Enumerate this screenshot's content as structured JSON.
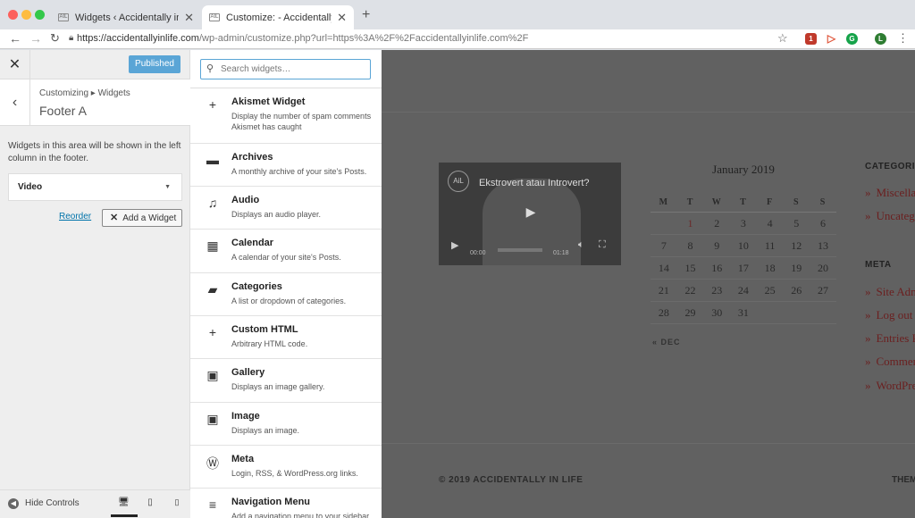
{
  "browser": {
    "tabs": [
      {
        "title": "Widgets ‹ Accidentally in Life —",
        "fav": "AIL",
        "close": "✕"
      },
      {
        "title": "Customize: - Accidentally in Life",
        "fav": "AIL",
        "close": "✕"
      }
    ],
    "new_tab": "+",
    "url_host": "https://accidentallyinlife.com",
    "url_path": "/wp-admin/customize.php?url=https%3A%2F%2Faccidentallyinlife.com%2F",
    "profile_initial": "L",
    "ext_badge": "1"
  },
  "customizer": {
    "published_label": "Published",
    "breadcrumb": "Customizing ▸ Widgets",
    "section_title": "Footer A",
    "description": "Widgets in this area will be shown in the left column in the footer.",
    "widget_item": "Video",
    "reorder_label": "Reorder",
    "add_widget_label": "Add a Widget",
    "hide_controls_label": "Hide Controls"
  },
  "widget_search": {
    "placeholder": "Search widgets…"
  },
  "widgets": [
    {
      "icon": "+",
      "title": "Akismet Widget",
      "desc": "Display the number of spam comments Akismet has caught"
    },
    {
      "icon": "▬",
      "title": "Archives",
      "desc": "A monthly archive of your site's Posts."
    },
    {
      "icon": "♫",
      "title": "Audio",
      "desc": "Displays an audio player."
    },
    {
      "icon": "▦",
      "title": "Calendar",
      "desc": "A calendar of your site's Posts."
    },
    {
      "icon": "▰",
      "title": "Categories",
      "desc": "A list or dropdown of categories."
    },
    {
      "icon": "+",
      "title": "Custom HTML",
      "desc": "Arbitrary HTML code."
    },
    {
      "icon": "▣",
      "title": "Gallery",
      "desc": "Displays an image gallery."
    },
    {
      "icon": "▣",
      "title": "Image",
      "desc": "Displays an image."
    },
    {
      "icon": "Ⓦ",
      "title": "Meta",
      "desc": "Login, RSS, & WordPress.org links."
    },
    {
      "icon": "≡",
      "title": "Navigation Menu",
      "desc": "Add a navigation menu to your sidebar."
    }
  ],
  "preview": {
    "video_title": "Ekstrovert atau Introvert?",
    "video_logo": "AiL",
    "video_time_start": "00:00",
    "video_time_end": "01:18",
    "calendar_title": "January 2019",
    "calendar_days": [
      "M",
      "T",
      "W",
      "T",
      "F",
      "S",
      "S"
    ],
    "calendar_rows": [
      [
        "",
        "1",
        "2",
        "3",
        "4",
        "5",
        "6"
      ],
      [
        "7",
        "8",
        "9",
        "10",
        "11",
        "12",
        "13"
      ],
      [
        "14",
        "15",
        "16",
        "17",
        "18",
        "19",
        "20"
      ],
      [
        "21",
        "22",
        "23",
        "24",
        "25",
        "26",
        "27"
      ],
      [
        "28",
        "29",
        "30",
        "31",
        "",
        "",
        ""
      ]
    ],
    "calendar_prev": "« DEC",
    "categories_heading": "CATEGORIES",
    "categories": [
      "Miscellaneous",
      "Uncategorized"
    ],
    "meta_heading": "META",
    "meta_links": [
      "Site Admin",
      "Log out",
      "Entries RSS",
      "Comments RSS",
      "WordPress.org"
    ],
    "copyright": "© 2019 ACCIDENTALLY IN LIFE",
    "theme_text": "THEME"
  }
}
